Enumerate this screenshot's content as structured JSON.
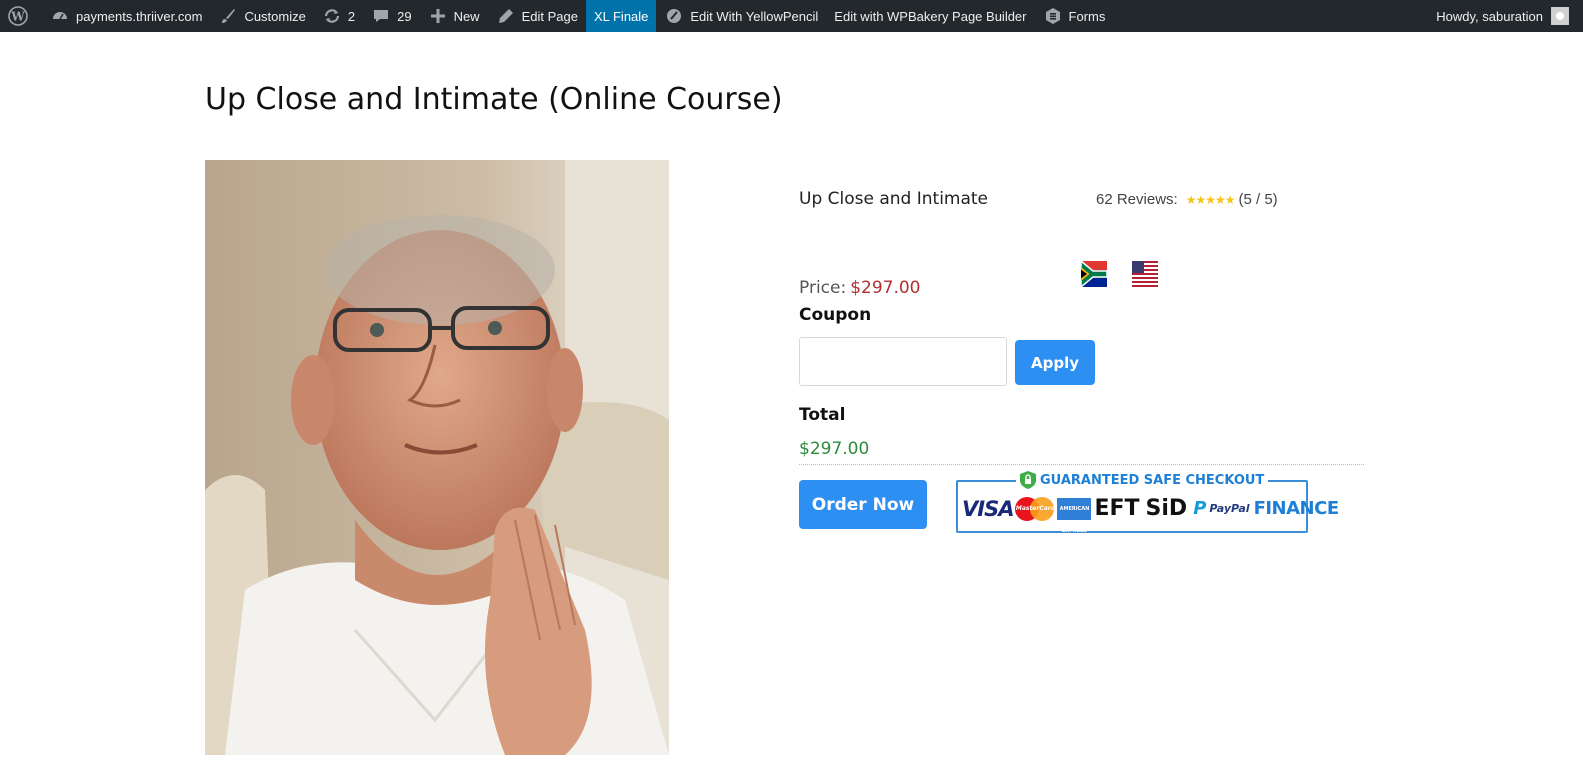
{
  "adminbar": {
    "site": "payments.thriiver.com",
    "customize": "Customize",
    "updates_count": "2",
    "comments_count": "29",
    "new": "New",
    "edit_page": "Edit Page",
    "xl_finale": "XL Finale",
    "edit_yellowpencil": "Edit With YellowPencil",
    "edit_wpbakery": "Edit with WPBakery Page Builder",
    "forms": "Forms",
    "howdy": "Howdy, saburation"
  },
  "page": {
    "title": "Up Close and Intimate (Online Course)"
  },
  "product": {
    "name": "Up Close and Intimate",
    "reviews_label": "62 Reviews:",
    "rating_stars": 5,
    "rating_text": "(5 / 5)",
    "price_label": "Price:",
    "price": "$297.00",
    "coupon_label": "Coupon",
    "coupon_value": "",
    "apply_label": "Apply",
    "total_label": "Total",
    "total": "$297.00",
    "order_label": "Order Now"
  },
  "checkout_badge": {
    "title": "GUARANTEED SAFE CHECKOUT",
    "visa": "VISA",
    "mastercard": "MasterCard",
    "amex": "AMERICAN EXPRESS",
    "eft": "EFT",
    "sid": "SiD",
    "paypal": "PayPal",
    "finance": "FINANCE"
  },
  "flags": [
    "south-africa-flag",
    "usa-flag"
  ],
  "colors": {
    "adminbar_bg": "#23282d",
    "adminbar_active": "#0073aa",
    "button_blue": "#2e8ff3",
    "price_red": "#b03030",
    "total_green": "#2e8b3c",
    "star_gold": "#f5c518"
  }
}
